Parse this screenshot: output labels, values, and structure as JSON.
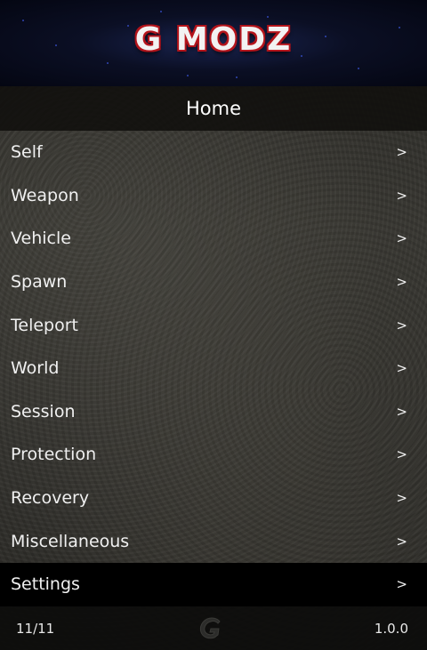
{
  "banner": {
    "logo_text": "G MODZ"
  },
  "header": {
    "title": "Home"
  },
  "menu": {
    "items": [
      {
        "label": "Self",
        "arrow": ">"
      },
      {
        "label": "Weapon",
        "arrow": ">"
      },
      {
        "label": "Vehicle",
        "arrow": ">"
      },
      {
        "label": "Spawn",
        "arrow": ">"
      },
      {
        "label": "Teleport",
        "arrow": ">"
      },
      {
        "label": "World",
        "arrow": ">"
      },
      {
        "label": "Session",
        "arrow": ">"
      },
      {
        "label": "Protection",
        "arrow": ">"
      },
      {
        "label": "Recovery",
        "arrow": ">"
      },
      {
        "label": "Miscellaneous",
        "arrow": ">"
      },
      {
        "label": "Settings",
        "arrow": ">"
      }
    ],
    "selected_index": 10
  },
  "footer": {
    "position": "11/11",
    "version": "1.0.0",
    "logo_icon": "g-logo-icon"
  },
  "colors": {
    "banner_accent": "#3b55d8",
    "logo_outline": "#b0141b",
    "selected_bg": "#000000",
    "text": "#f0f0f0"
  }
}
